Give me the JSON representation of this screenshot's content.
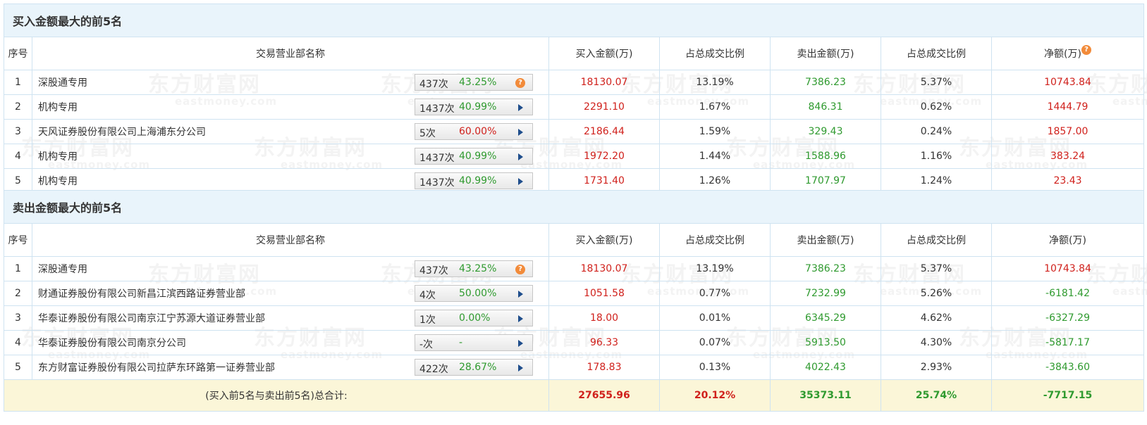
{
  "watermark": {
    "brand": "东方财富网",
    "site": "eastmoney.com"
  },
  "columns": {
    "index": "序号",
    "name": "交易营业部名称",
    "buy": "买入金额(万)",
    "buy_ratio": "占总成交比例",
    "sell": "卖出金额(万)",
    "sell_ratio": "占总成交比例",
    "net": "净额(万)"
  },
  "buy_section": {
    "title": "买入金额最大的前5名",
    "rows": [
      {
        "idx": "1",
        "name": "深股通专用",
        "count": "437次",
        "pct": "43.25%",
        "icon": "question-icon",
        "buy": "18130.07",
        "buy_ratio": "13.19%",
        "sell": "7386.23",
        "sell_ratio": "5.37%",
        "net": "10743.84"
      },
      {
        "idx": "2",
        "name": "机构专用",
        "count": "1437次",
        "pct": "40.99%",
        "icon": "arrow-right-icon",
        "buy": "2291.10",
        "buy_ratio": "1.67%",
        "sell": "846.31",
        "sell_ratio": "0.62%",
        "net": "1444.79"
      },
      {
        "idx": "3",
        "name": "天风证券股份有限公司上海浦东分公司",
        "count": "5次",
        "pct": "60.00%",
        "icon": "arrow-right-icon",
        "buy": "2186.44",
        "buy_ratio": "1.59%",
        "sell": "329.43",
        "sell_ratio": "0.24%",
        "net": "1857.00"
      },
      {
        "idx": "4",
        "name": "机构专用",
        "count": "1437次",
        "pct": "40.99%",
        "icon": "arrow-right-icon",
        "buy": "1972.20",
        "buy_ratio": "1.44%",
        "sell": "1588.96",
        "sell_ratio": "1.16%",
        "net": "383.24"
      },
      {
        "idx": "5",
        "name": "机构专用",
        "count": "1437次",
        "pct": "40.99%",
        "icon": "arrow-right-icon",
        "buy": "1731.40",
        "buy_ratio": "1.26%",
        "sell": "1707.97",
        "sell_ratio": "1.24%",
        "net": "23.43"
      }
    ]
  },
  "sell_section": {
    "title": "卖出金额最大的前5名",
    "rows": [
      {
        "idx": "1",
        "name": "深股通专用",
        "count": "437次",
        "pct": "43.25%",
        "icon": "question-icon",
        "buy": "18130.07",
        "buy_ratio": "13.19%",
        "sell": "7386.23",
        "sell_ratio": "5.37%",
        "net": "10743.84"
      },
      {
        "idx": "2",
        "name": "财通证券股份有限公司新昌江滨西路证券营业部",
        "count": "4次",
        "pct": "50.00%",
        "icon": "arrow-right-icon",
        "buy": "1051.58",
        "buy_ratio": "0.77%",
        "sell": "7232.99",
        "sell_ratio": "5.26%",
        "net": "-6181.42"
      },
      {
        "idx": "3",
        "name": "华泰证券股份有限公司南京江宁苏源大道证券营业部",
        "count": "1次",
        "pct": "0.00%",
        "icon": "arrow-right-icon",
        "buy": "18.00",
        "buy_ratio": "0.01%",
        "sell": "6345.29",
        "sell_ratio": "4.62%",
        "net": "-6327.29"
      },
      {
        "idx": "4",
        "name": "华泰证券股份有限公司南京分公司",
        "count": "-次",
        "pct": "-",
        "icon": "arrow-right-icon",
        "buy": "96.33",
        "buy_ratio": "0.07%",
        "sell": "5913.50",
        "sell_ratio": "4.30%",
        "net": "-5817.17"
      },
      {
        "idx": "5",
        "name": "东方财富证券股份有限公司拉萨东环路第一证券营业部",
        "count": "422次",
        "pct": "28.67%",
        "icon": "arrow-right-icon",
        "buy": "178.83",
        "buy_ratio": "0.13%",
        "sell": "4022.43",
        "sell_ratio": "2.93%",
        "net": "-3843.60"
      }
    ]
  },
  "total": {
    "label": "(买入前5名与卖出前5名)总合计:",
    "buy": "27655.96",
    "buy_ratio": "20.12%",
    "sell": "35373.11",
    "sell_ratio": "25.74%",
    "net": "-7717.15"
  },
  "colors": {
    "red": "#d0211c",
    "green": "#2f9a2f",
    "header_bg": "#e9f4fb",
    "total_bg": "#fbf6d8",
    "border": "#cfe3f1"
  }
}
